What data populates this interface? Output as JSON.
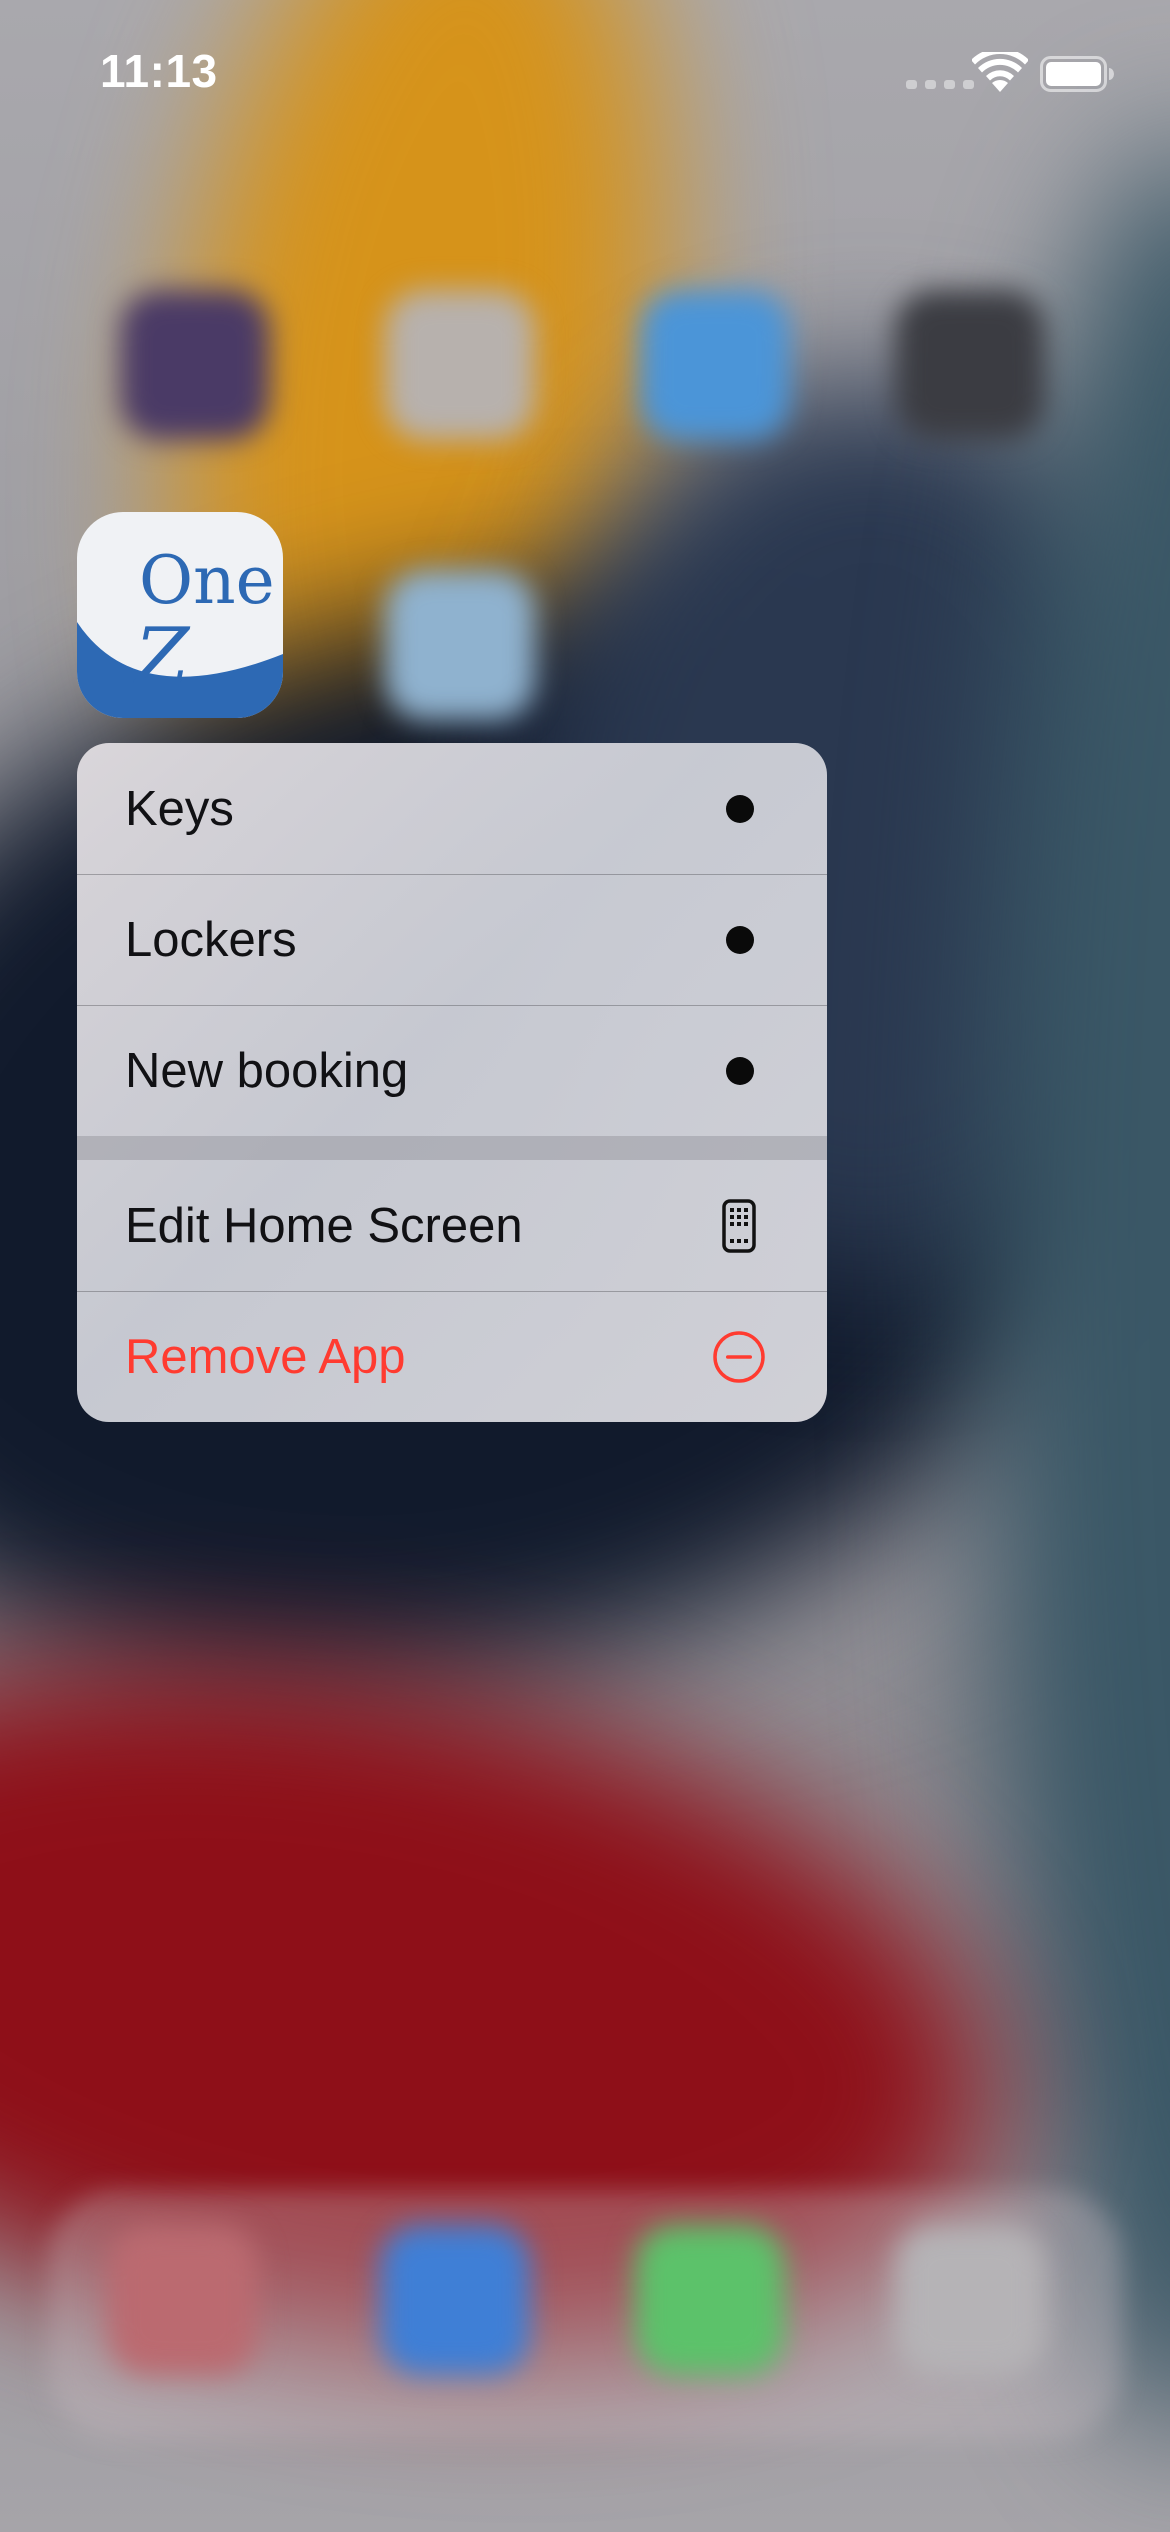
{
  "status_bar": {
    "time": "11:13",
    "signal_icon": "cellular-signal-icon",
    "wifi_icon": "wifi-icon",
    "battery_icon": "battery-icon"
  },
  "app": {
    "name_icon": "onez-app-icon",
    "logo_line1": "One",
    "logo_line2": "Z",
    "brand_color": "#2d69b4"
  },
  "quick_actions": {
    "items": [
      {
        "label": "Keys",
        "icon": "bullet-dot-icon"
      },
      {
        "label": "Lockers",
        "icon": "bullet-dot-icon"
      },
      {
        "label": "New booking",
        "icon": "bullet-dot-icon"
      }
    ],
    "system_items": [
      {
        "label": "Edit Home Screen",
        "icon": "phone-grid-icon"
      },
      {
        "label": "Remove App",
        "icon": "minus-circle-icon",
        "color": "#ff3b30"
      }
    ]
  }
}
